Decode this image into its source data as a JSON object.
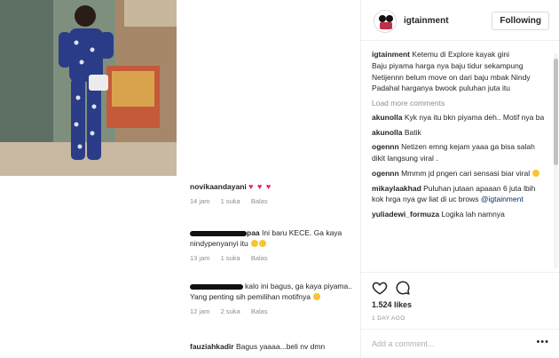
{
  "post": {
    "author": "igtainment",
    "follow_label": "Following",
    "caption_user": "igtainment",
    "caption_lines": [
      "Ketemu di Explore kayak gini",
      "Baju piyama harga nya baju tidur sekampung",
      "Netijennn belum move on dari baju mbak Nindy",
      "Padahal harganya bwook puluhan juta itu"
    ],
    "load_more": "Load more comments",
    "likes": "1.524 likes",
    "date": "1 DAY AGO",
    "add_comment_placeholder": "Add a comment...",
    "more_label": "•••"
  },
  "comments": [
    {
      "user": "akunolla",
      "text": "Kyk nya itu bkn piyama deh.. Motif nya ba"
    },
    {
      "user": "akunolla",
      "text": "Batik"
    },
    {
      "user": "ogennn",
      "text": "Netizen emng kejam yaaa ga bisa salah dikit langsung viral ."
    },
    {
      "user": "ogennn",
      "text": "Mmmm jd pngen cari sensasi biar viral"
    },
    {
      "user": "mikaylaakhad",
      "text": "Puluhan jutaan apaaan 6 juta lbih kok hrga nya gw liat di uc brows",
      "tag": "@igtainment"
    },
    {
      "user": "yuliadewi_formuza",
      "text": "Logika lah namnya"
    }
  ],
  "left_comments": [
    {
      "user": "novikaandayani",
      "text": "",
      "hearts": "♥ ♥ ♥"
    },
    {
      "user": "",
      "suffix": "paa",
      "text": "Ini baru KECE. Ga kaya nindypenyanyi itu",
      "time": "13 jam",
      "likes": "1 suka",
      "reply": "Balas"
    },
    {
      "user": "",
      "suffix": "",
      "text": "kalo ini bagus, ga kaya piyama.. Yang penting sih pemilihan motifnya",
      "time": "12 jam",
      "likes": "2 suka",
      "reply": "Balas"
    },
    {
      "user": "fauziahkadir",
      "text": "Bagus yaaaa...beli nv dmn"
    }
  ],
  "left_first_meta": {
    "time": "14 jam",
    "likes": "1 suka",
    "reply": "Balas"
  },
  "colors": {
    "heart": "#e0245e",
    "link": "#003569",
    "muted": "#8e8e8e"
  }
}
